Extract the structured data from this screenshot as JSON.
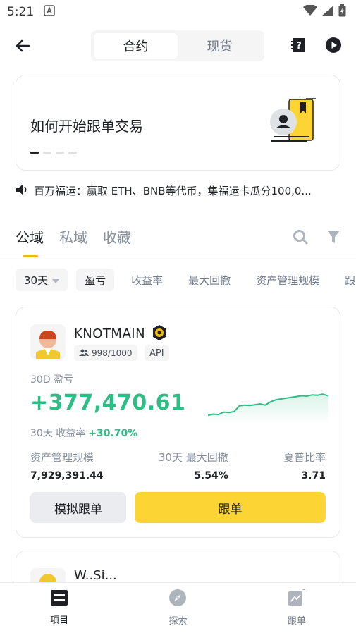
{
  "status_bar": {
    "time": "5:21"
  },
  "header": {
    "tabs": [
      {
        "label": "合约"
      },
      {
        "label": "现货"
      }
    ]
  },
  "banner": {
    "title": "如何开始跟单交易"
  },
  "notice": {
    "text": "百万福运：赢取 ETH、BNB等代币，集福运卡瓜分100,0..."
  },
  "main_tabs": [
    {
      "label": "公域"
    },
    {
      "label": "私域"
    },
    {
      "label": "收藏"
    }
  ],
  "filters": {
    "period": "30天",
    "chips": [
      "盈亏",
      "收益率",
      "最大回撤",
      "资产管理规模",
      "跟"
    ]
  },
  "trader_card": {
    "name": "KNOTMAIN",
    "followers": "998/1000",
    "api_badge": "API",
    "pnl_label": "30D 盈亏",
    "pnl_value": "+377,470.61",
    "roi_label": "30天 收益率",
    "roi_value": "+30.70%",
    "stats": [
      {
        "label": "资产管理规模",
        "value": "7,929,391.44"
      },
      {
        "label": "30天 最大回撤",
        "value": "5.54%"
      },
      {
        "label": "夏普比率",
        "value": "3.71"
      }
    ],
    "mock_button": "模拟跟单",
    "copy_button": "跟单",
    "sparkline": [
      0.22,
      0.25,
      0.24,
      0.3,
      0.29,
      0.31,
      0.45,
      0.47,
      0.46,
      0.48,
      0.5,
      0.47,
      0.55,
      0.6,
      0.62,
      0.64,
      0.66,
      0.68,
      0.7,
      0.69,
      0.72,
      0.71,
      0.74,
      0.7
    ]
  },
  "trader_card_2": {
    "name": "W..Si..."
  },
  "bottom_nav": [
    {
      "label": "项目"
    },
    {
      "label": "探索"
    },
    {
      "label": "跟单"
    }
  ],
  "colors": {
    "accent": "#fcd535",
    "positive": "#2ebd85",
    "tab_underline": "#f0b90b"
  }
}
